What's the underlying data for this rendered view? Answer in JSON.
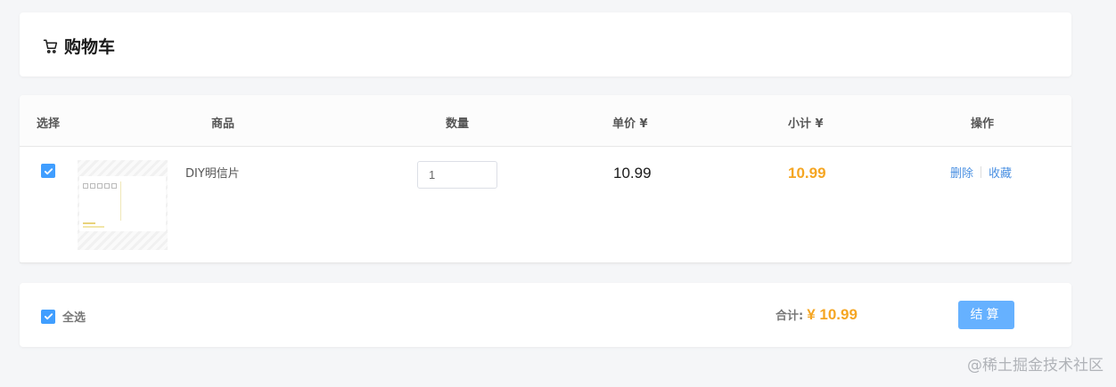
{
  "header": {
    "title": "购物车",
    "icon": "cart-icon"
  },
  "table": {
    "columns": {
      "select": "选择",
      "product": "商品",
      "quantity": "数量",
      "unit_price": "单价 ¥",
      "subtotal": "小计 ¥",
      "actions": "操作"
    },
    "rows": [
      {
        "checked": true,
        "product_name": "DIY明信片",
        "quantity": "1",
        "unit_price": "10.99",
        "subtotal": "10.99",
        "delete_label": "删除",
        "favorite_label": "收藏"
      }
    ]
  },
  "footer": {
    "select_all_label": "全选",
    "total_label": "合计:",
    "total_value": "¥ 10.99",
    "checkout_label": "结算"
  },
  "watermark": "@稀土掘金技术社区",
  "colors": {
    "accent": "#409eff",
    "price_highlight": "#f5a623",
    "link": "#4a90e2",
    "button": "#66b1ff",
    "background": "#f5f6f8"
  }
}
